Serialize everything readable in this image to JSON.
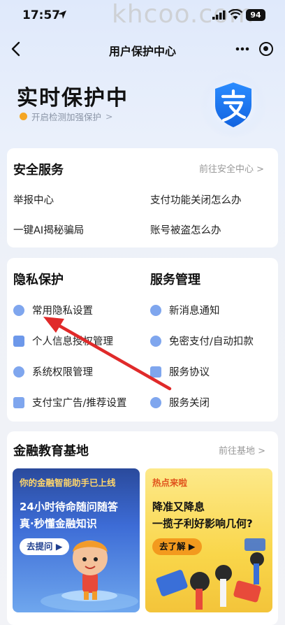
{
  "status": {
    "time": "17:57",
    "battery": "94",
    "watermark": "khcoo.com"
  },
  "nav": {
    "title": "用户保护中心"
  },
  "hero": {
    "title": "实时保护中",
    "subtitle": "开启检测加强保护",
    "subtitle_chevron": ">"
  },
  "security": {
    "title": "安全服务",
    "link": "前往安全中心 >",
    "items": [
      "举报中心",
      "支付功能关闭怎么办",
      "一键AI揭秘骗局",
      "账号被盗怎么办"
    ]
  },
  "privacy": {
    "title": "隐私保护",
    "items": [
      "常用隐私设置",
      "个人信息授权管理",
      "系统权限管理",
      "支付宝广告/推荐设置"
    ]
  },
  "service": {
    "title": "服务管理",
    "items": [
      "新消息通知",
      "免密支付/自动扣款",
      "服务协议",
      "服务关闭"
    ]
  },
  "finance": {
    "title": "金融教育基地",
    "link": "前往基地 >",
    "left_card": {
      "tag": "你的金融智能助手已上线",
      "line1": "24小时待命随问随答",
      "line2": "真·秒懂金融知识",
      "button": "去提问 ▶"
    },
    "right_card": {
      "tag": "热点来啦",
      "line1": "降准又降息",
      "line2": "一揽子利好影响几何?",
      "button": "去了解 ▶"
    }
  },
  "colors": {
    "accent_blue": "#1677ff",
    "annotation_red": "#e02a2a",
    "hero_bg": "#dfe9fb"
  }
}
